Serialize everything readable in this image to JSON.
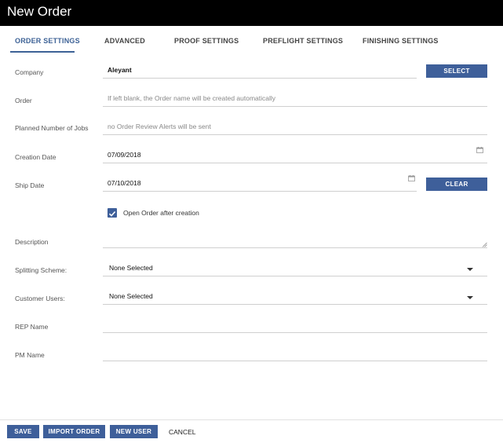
{
  "window": {
    "title": "New Order"
  },
  "tabs": [
    {
      "label": "ORDER SETTINGS",
      "active": true
    },
    {
      "label": "ADVANCED",
      "active": false
    },
    {
      "label": "PROOF SETTINGS",
      "active": false
    },
    {
      "label": "PREFLIGHT SETTINGS",
      "active": false
    },
    {
      "label": "FINISHING SETTINGS",
      "active": false
    }
  ],
  "form": {
    "company": {
      "label": "Company",
      "value": "Aleyant",
      "button": "SELECT"
    },
    "order": {
      "label": "Order",
      "placeholder": "If left blank, the Order name will be created automatically"
    },
    "planned_jobs": {
      "label": "Planned Number of Jobs",
      "placeholder": "no Order Review Alerts will be sent"
    },
    "creation_date": {
      "label": "Creation Date",
      "value": "07/09/2018",
      "icon": "calendar-icon"
    },
    "ship_date": {
      "label": "Ship Date",
      "value": "07/10/2018",
      "icon": "calendar-icon",
      "button": "CLEAR"
    },
    "open_after": {
      "label": "Open Order after creation",
      "checked": true
    },
    "description": {
      "label": "Description",
      "value": ""
    },
    "splitting_scheme": {
      "label": "Splitting Scheme:",
      "value": "None Selected"
    },
    "customer_users": {
      "label": "Customer Users:",
      "value": "None Selected"
    },
    "rep_name": {
      "label": "REP Name",
      "value": ""
    },
    "pm_name": {
      "label": "PM Name",
      "value": ""
    }
  },
  "footer": {
    "save": "SAVE",
    "import_order": "IMPORT ORDER",
    "new_user": "NEW USER",
    "cancel": "CANCEL"
  },
  "colors": {
    "accent": "#3e5f9a",
    "titlebar": "#000000",
    "active_tab": "#3d6296"
  }
}
